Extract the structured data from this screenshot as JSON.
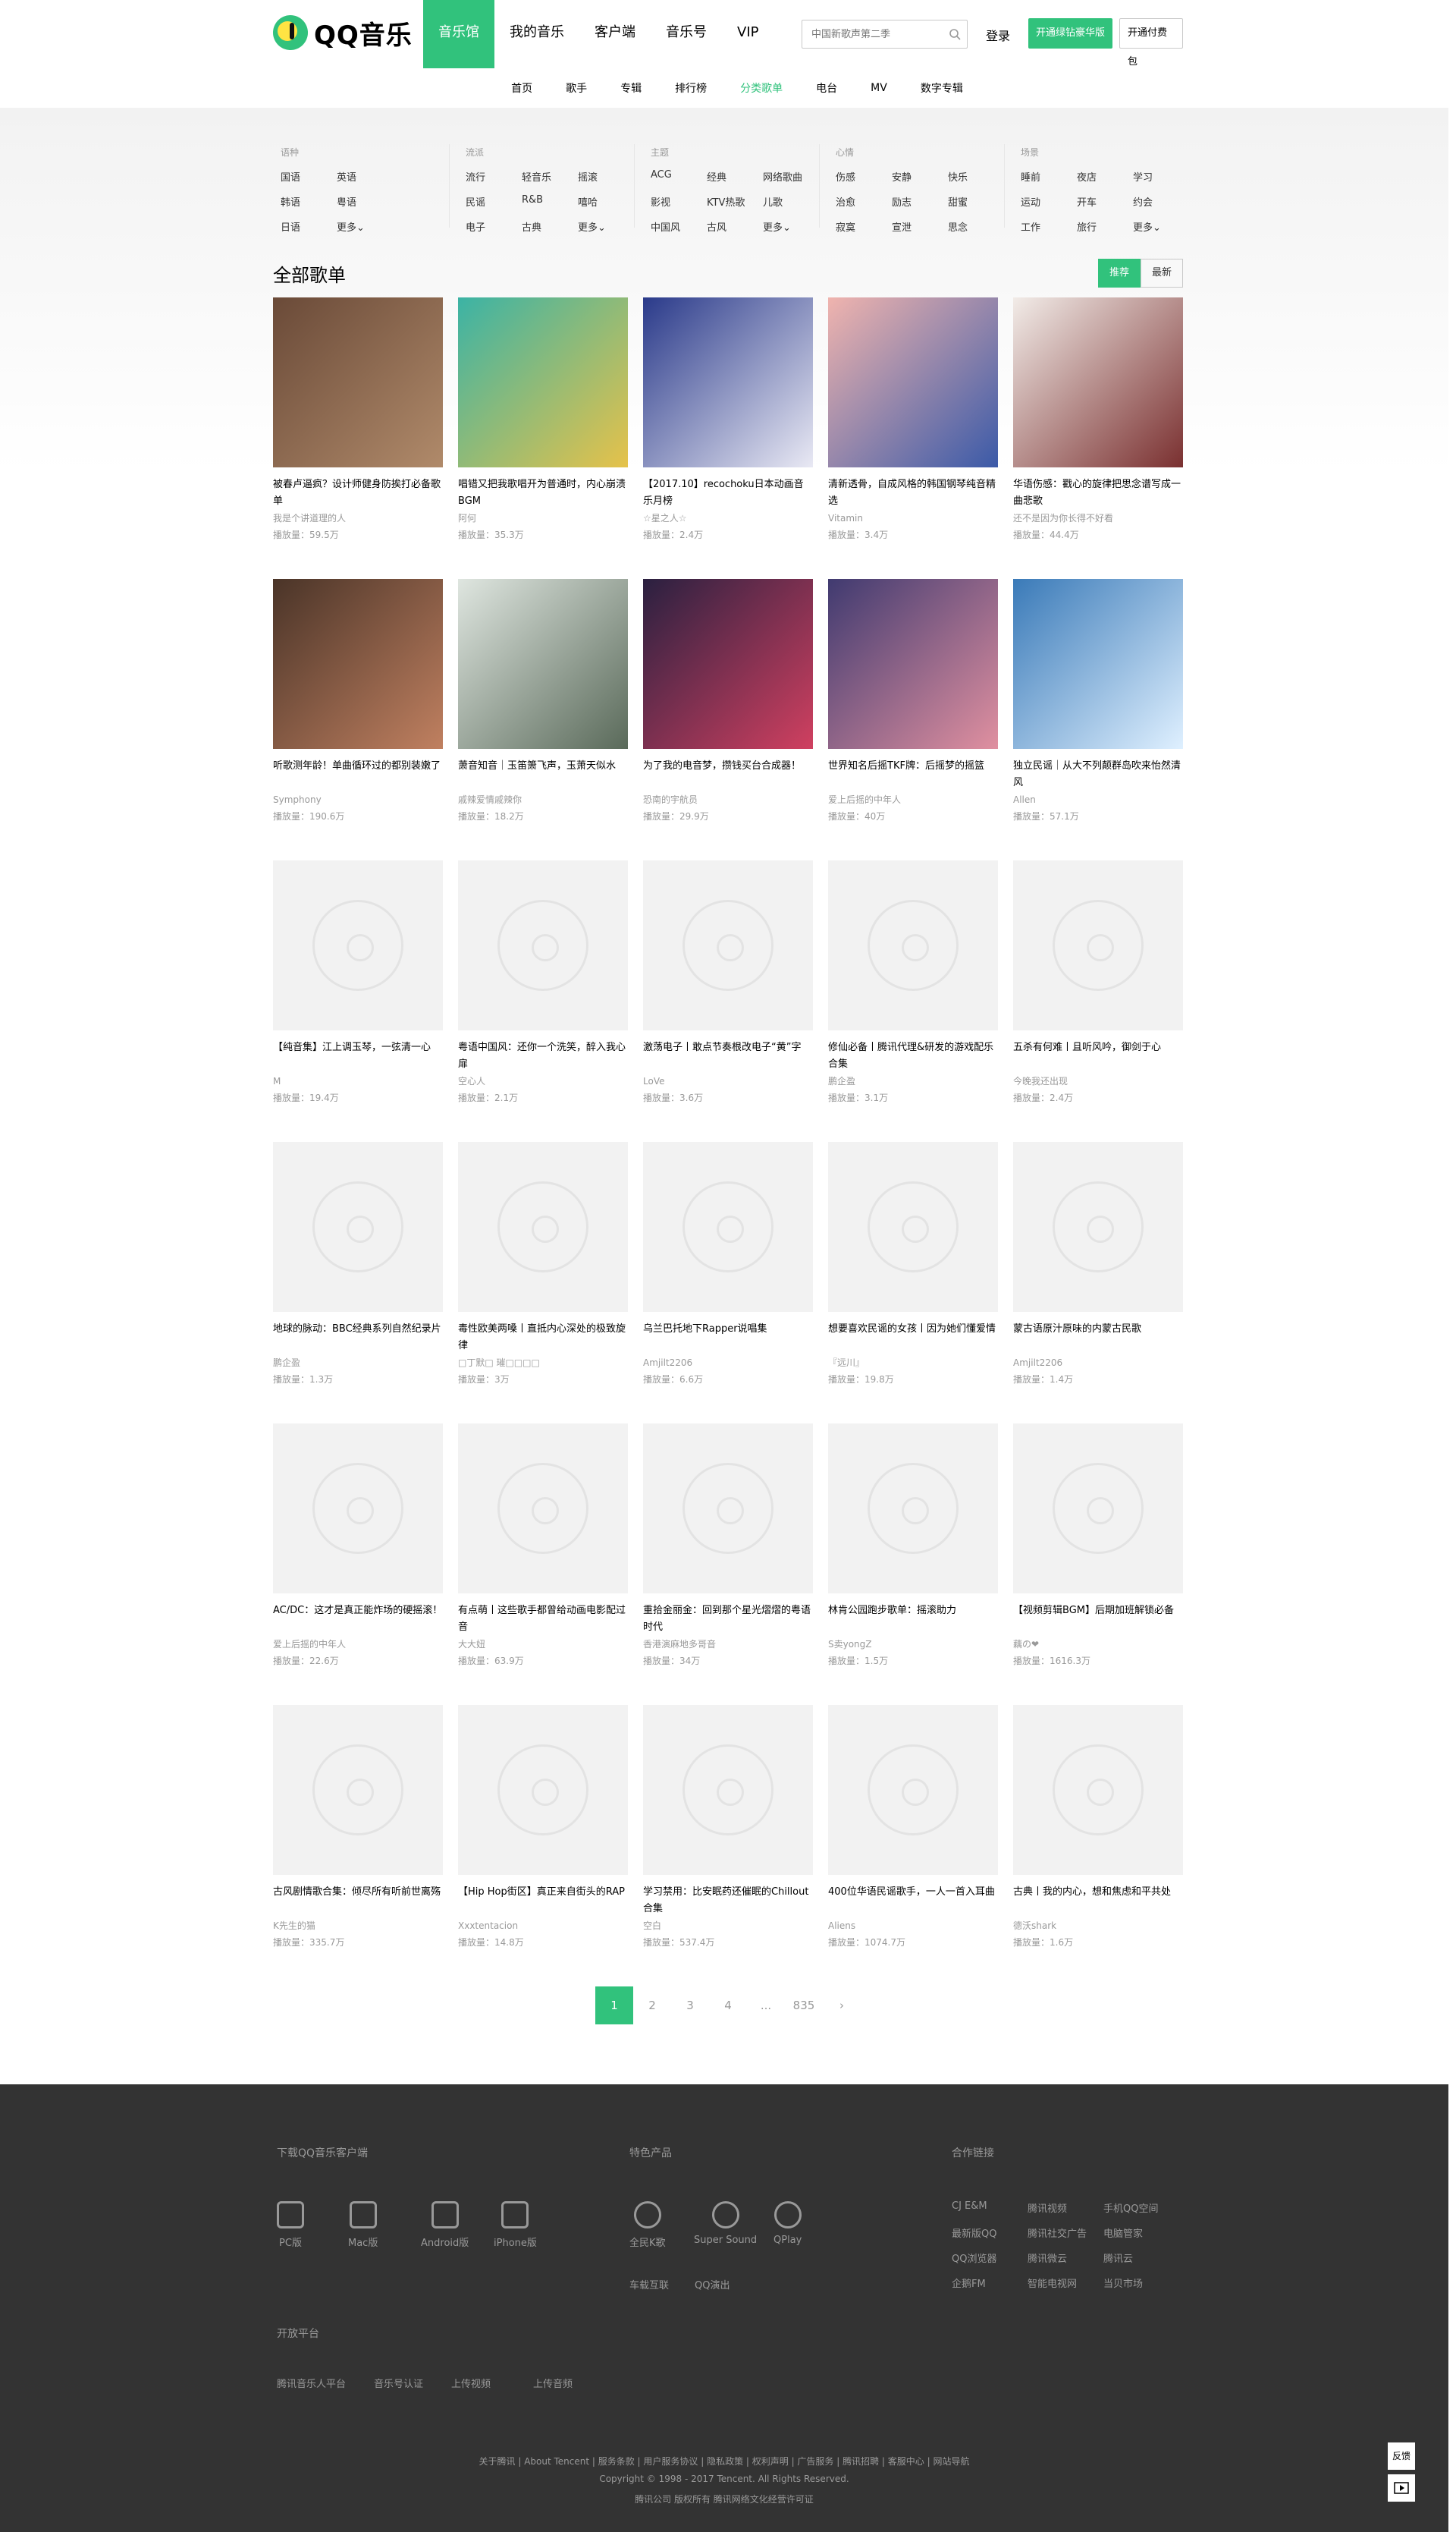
{
  "header": {
    "logo_text": "QQ音乐",
    "nav": [
      "音乐馆",
      "我的音乐",
      "客户端",
      "音乐号",
      "VIP"
    ],
    "search_placeholder": "中国新歌声第二季",
    "login": "登录",
    "btn_green": "开通绿钻豪华版",
    "btn_pay": "开通付费包"
  },
  "subnav": [
    "首页",
    "歌手",
    "专辑",
    "排行榜",
    "分类歌单",
    "电台",
    "MV",
    "数字专辑"
  ],
  "categories": [
    {
      "title": "语种",
      "items": [
        "国语",
        "英语",
        "",
        "韩语",
        "粤语",
        "",
        "日语",
        "更多⌄",
        ""
      ]
    },
    {
      "title": "流派",
      "items": [
        "流行",
        "轻音乐",
        "摇滚",
        "民谣",
        "R&B",
        "嘻哈",
        "电子",
        "古典",
        "更多⌄"
      ]
    },
    {
      "title": "主题",
      "items": [
        "ACG",
        "经典",
        "网络歌曲",
        "影视",
        "KTV热歌",
        "儿歌",
        "中国风",
        "古风",
        "更多⌄"
      ]
    },
    {
      "title": "心情",
      "items": [
        "伤感",
        "安静",
        "快乐",
        "治愈",
        "励志",
        "甜蜜",
        "寂寞",
        "宣泄",
        "思念"
      ]
    },
    {
      "title": "场景",
      "items": [
        "睡前",
        "夜店",
        "学习",
        "运动",
        "开车",
        "约会",
        "工作",
        "旅行",
        "更多⌄"
      ]
    }
  ],
  "section_title": "全部歌单",
  "sort": [
    "推荐",
    "最新"
  ],
  "playlists": [
    {
      "title": "被春卢逼疯？设计师健身防挨打必备歌单",
      "author": "我是个讲道理的人",
      "plays": "播放量：59.5万"
    },
    {
      "title": "唱错又把我歌唱开为普通时，内心崩溃BGM",
      "author": "阿何",
      "plays": "播放量：35.3万"
    },
    {
      "title": "【2017.10】recochoku日本动画音乐月榜",
      "author": "☆星之人☆",
      "plays": "播放量：2.4万"
    },
    {
      "title": "清新透骨，自成风格的韩国钢琴纯音精选",
      "author": "Vitamin",
      "plays": "播放量：3.4万"
    },
    {
      "title": "华语伤感：戳心的旋律把思念谱写成一曲悲歌",
      "author": "还不是因为你长得不好看",
      "plays": "播放量：44.4万"
    },
    {
      "title": "听歌测年龄！单曲循环过的都别装嫩了",
      "author": "Symphony",
      "plays": "播放量：190.6万"
    },
    {
      "title": "萧音知音｜玉笛箫飞声，玉萧天似水",
      "author": "戚辣爱情戚辣你",
      "plays": "播放量：18.2万"
    },
    {
      "title": "为了我的电音梦，攒钱买台合成器！",
      "author": "恐南的宇航员",
      "plays": "播放量：29.9万"
    },
    {
      "title": "世界知名后摇TKF牌：后摇梦的摇篮",
      "author": "爱上后摇的中年人",
      "plays": "播放量：40万"
    },
    {
      "title": "独立民谣｜从大不列颠群岛吹来怡然清风",
      "author": "Allen",
      "plays": "播放量：57.1万"
    },
    {
      "title": "【纯音集】江上调玉琴，一弦清一心",
      "author": "M",
      "plays": "播放量：19.4万"
    },
    {
      "title": "粤语中国风：还你一个洗笑，醉入我心扉",
      "author": "空心人",
      "plays": "播放量：2.1万"
    },
    {
      "title": "激荡电子丨敢点节奏根改电子“黄”字",
      "author": "LoVe",
      "plays": "播放量：3.6万"
    },
    {
      "title": "修仙必备丨腾讯代理&研发的游戏配乐合集",
      "author": "鹏企盈",
      "plays": "播放量：3.1万"
    },
    {
      "title": "五杀有何难丨且听风吟，御剑于心",
      "author": "今晚我还出现",
      "plays": "播放量：2.4万"
    },
    {
      "title": "地球的脉动：BBC经典系列自然纪录片",
      "author": "鹏企盈",
      "plays": "播放量：1.3万"
    },
    {
      "title": "毒性欧美两嗓丨直抵内心深处的极致旋律",
      "author": "□丁默□ 璀□□□□",
      "plays": "播放量：3万"
    },
    {
      "title": "乌兰巴托地下Rapper说唱集",
      "author": "Amjilt2206",
      "plays": "播放量：6.6万"
    },
    {
      "title": "想要喜欢民谣的女孩丨因为她们懂爱情",
      "author": "『远川』",
      "plays": "播放量：19.8万"
    },
    {
      "title": "蒙古语原汁原味的内蒙古民歌",
      "author": "Amjilt2206",
      "plays": "播放量：1.4万"
    },
    {
      "title": "AC/DC：这才是真正能炸场的硬摇滚！",
      "author": "爱上后摇的中年人",
      "plays": "播放量：22.6万"
    },
    {
      "title": "有点萌丨这些歌手都曾给动画电影配过音",
      "author": "大大妞",
      "plays": "播放量：63.9万"
    },
    {
      "title": "重拾金丽金：回到那个星光熠熠的粤语时代",
      "author": "香港演麻地多哥音",
      "plays": "播放量：34万"
    },
    {
      "title": "林肯公园跑步歌单：摇滚助力",
      "author": "S卖yongZ",
      "plays": "播放量：1.5万"
    },
    {
      "title": "【视频剪辑BGM】后期加班解锁必备",
      "author": "藕の❤",
      "plays": "播放量：1616.3万"
    },
    {
      "title": "古风剧情歌合集：倾尽所有听前世离殇",
      "author": "K先生的猫",
      "plays": "播放量：335.7万"
    },
    {
      "title": "【Hip Hop街区】真正来自街头的RAP",
      "author": "Xxxtentacion",
      "plays": "播放量：14.8万"
    },
    {
      "title": "学习禁用：比安眠药还催眠的Chillout合集",
      "author": "空白",
      "plays": "播放量：537.4万"
    },
    {
      "title": "400位华语民谣歌手，一人一首入耳曲",
      "author": "Aliens",
      "plays": "播放量：1074.7万"
    },
    {
      "title": "古典丨我的内心，想和焦虑和平共处",
      "author": "德沃shark",
      "plays": "播放量：1.6万"
    }
  ],
  "pager": [
    "1",
    "2",
    "3",
    "4",
    "...",
    "835",
    "›"
  ],
  "footer": {
    "download_title": "下载QQ音乐客户端",
    "downloads": [
      "PC版",
      "Mac版",
      "Android版",
      "iPhone版"
    ],
    "products_title": "特色产品",
    "products": [
      "全民K歌",
      "Super Sound",
      "QPlay"
    ],
    "products2": [
      "车载互联",
      "QQ演出"
    ],
    "partners_title": "合作链接",
    "partners": [
      "CJ E&M",
      "腾讯视频",
      "手机QQ空间",
      "最新版QQ",
      "腾讯社交广告",
      "电脑管家",
      "QQ浏览器",
      "腾讯微云",
      "腾讯云",
      "企鹅FM",
      "智能电视网",
      "当贝市场"
    ],
    "open_title": "开放平台",
    "open": [
      "腾讯音乐人平台",
      "音乐号认证",
      "上传视频",
      "上传音频"
    ],
    "legal1": "关于腾讯 | About Tencent | 服务条款 | 用户服务协议 | 隐私政策 | 权利声明 | 广告服务 | 腾讯招聘 | 客服中心 | 网站导航",
    "legal2": "Copyright © 1998 - 2017 Tencent. All Rights Reserved.",
    "legal3": "腾讯公司 版权所有 腾讯网络文化经营许可证",
    "feedback": "反馈"
  }
}
